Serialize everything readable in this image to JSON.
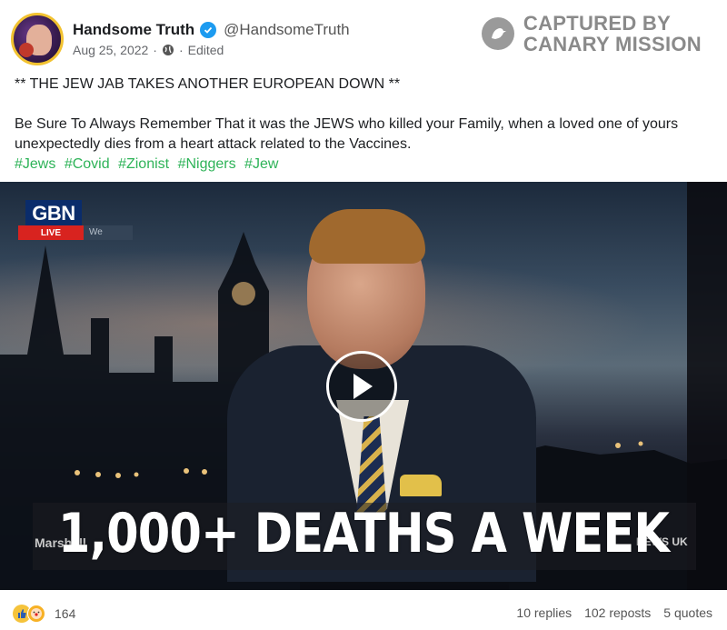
{
  "post": {
    "author_name": "Handsome Truth",
    "handle": "@HandsomeTruth",
    "date": "Aug 25, 2022",
    "separator": "·",
    "edited": "Edited"
  },
  "watermark": {
    "line1": "CAPTURED BY",
    "line2": "CANARY MISSION"
  },
  "body": {
    "line1": "** THE JEW JAB TAKES ANOTHER EUROPEAN DOWN **",
    "line2": "Be Sure To Always Remember That it was the JEWS who killed your Family, when a loved one of yours unexpectedly dies from a heart attack related to the Vaccines.",
    "hashtags": [
      "#Jews",
      "#Covid",
      "#Zionist",
      "#Niggers",
      "#Jew"
    ]
  },
  "video": {
    "channel_logo": "GBN",
    "live_label": "LIVE",
    "live_ext": "We",
    "ticker_left": "Marshall",
    "news_label": "NEWS UK",
    "headline": "1,000+ DEATHS A WEEK",
    "play_icon": "play-icon"
  },
  "footer": {
    "reaction_count": "164",
    "replies": "10 replies",
    "reposts": "102 reposts",
    "quotes": "5 quotes"
  },
  "colors": {
    "hashtag": "#2eb358",
    "verified": "#1d9bf0",
    "live_red": "#d8231f",
    "gbn_blue": "#0a2c6b"
  }
}
